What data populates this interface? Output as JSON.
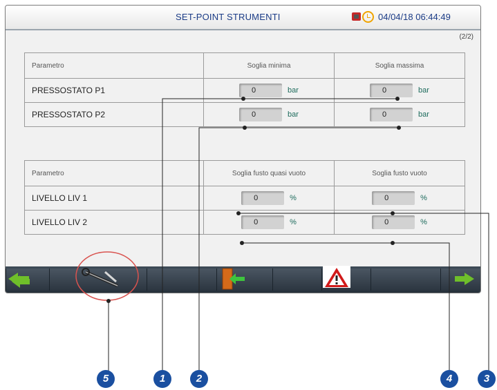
{
  "header": {
    "title": "SET-POINT STRUMENTI",
    "datetime": "04/04/18 06:44:49",
    "page": "(2/2)"
  },
  "icons": {
    "phone": "phone-icon",
    "clock": "clock-icon"
  },
  "pressure_table": {
    "headers": [
      "Parametro",
      "Soglia minima",
      "Soglia massima"
    ],
    "rows": [
      {
        "name": "PRESSOSTATO P1",
        "min": "0",
        "max": "0",
        "unit": "bar"
      },
      {
        "name": "PRESSOSTATO P2",
        "min": "0",
        "max": "0",
        "unit": "bar"
      }
    ]
  },
  "level_table": {
    "headers": [
      "Parametro",
      "Soglia fusto quasi vuoto",
      "Soglia fusto vuoto"
    ],
    "rows": [
      {
        "name": "LIVELLO LIV 1",
        "min": "0",
        "max": "0",
        "unit": "%"
      },
      {
        "name": "LIVELLO LIV 2",
        "min": "0",
        "max": "0",
        "unit": "%"
      }
    ]
  },
  "toolbar": {
    "buttons": [
      "arrow-left-icon",
      "wrench-icon",
      "exit-door-icon",
      "warning-icon",
      "arrow-right-icon"
    ]
  },
  "colors": {
    "title": "#1a3b86",
    "callout": "#1a4fa0",
    "toolbar": "#2c3640",
    "arrow": "#6fbf2a",
    "highlight": "#d9534f"
  },
  "callouts": [
    "5",
    "1",
    "2",
    "4",
    "3"
  ]
}
